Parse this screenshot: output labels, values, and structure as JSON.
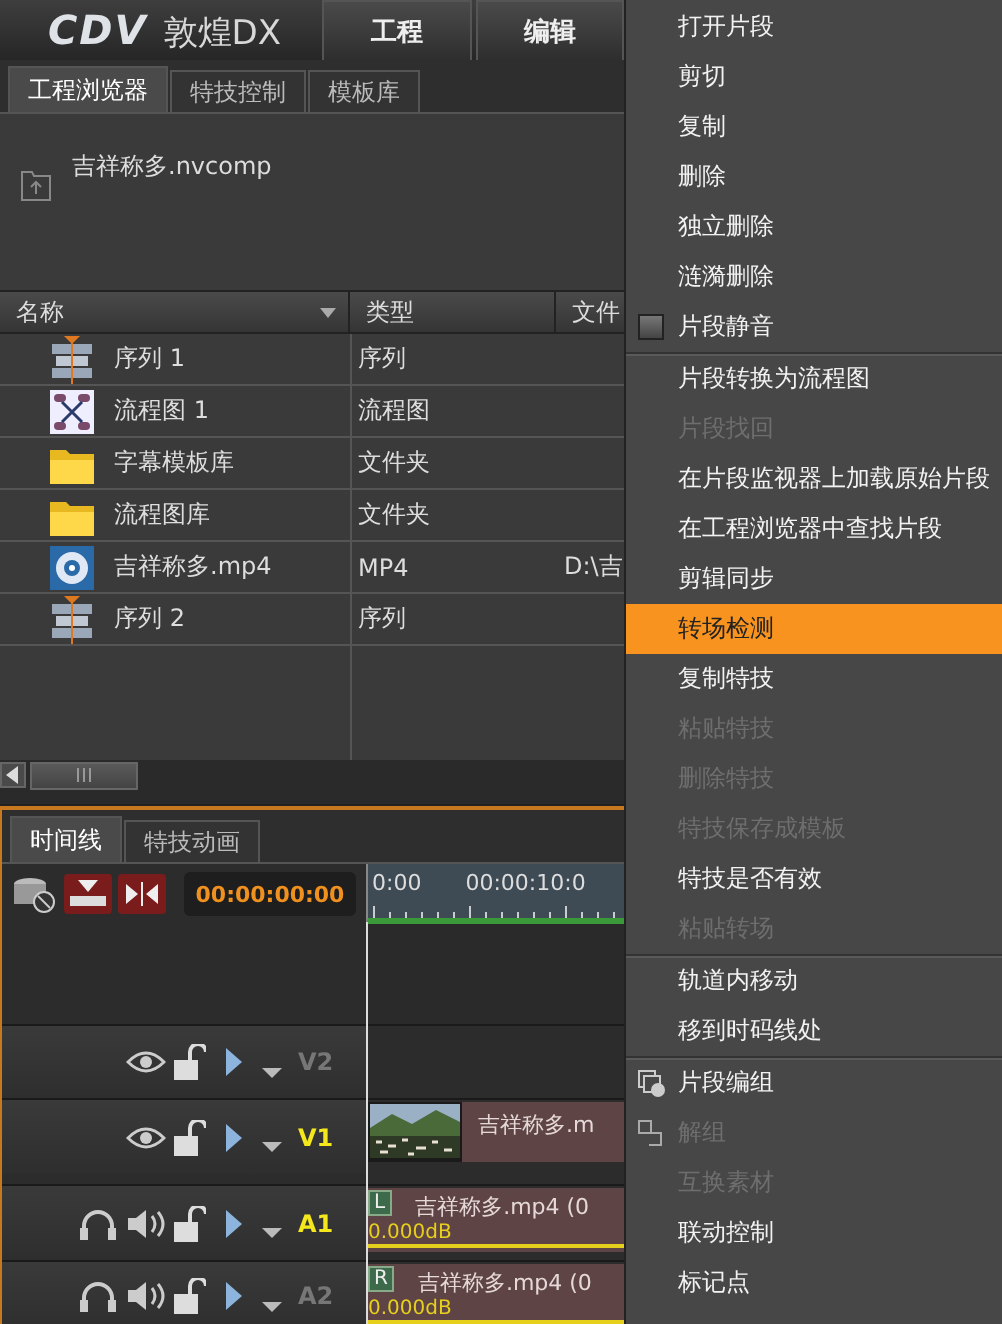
{
  "app": {
    "logo": "CDV",
    "product": "敦煌DX",
    "menus": [
      "工程",
      "编辑"
    ]
  },
  "browser": {
    "tabs": [
      {
        "label": "工程浏览器",
        "selected": true
      },
      {
        "label": "特技控制",
        "selected": false
      },
      {
        "label": "模板库",
        "selected": false
      }
    ],
    "project_file": "吉祥称多.nvcomp",
    "columns": [
      "名称",
      "类型",
      "文件"
    ],
    "rows": [
      {
        "kind": "sequence",
        "name": "序列 1",
        "type": "序列"
      },
      {
        "kind": "flowchart",
        "name": "流程图 1",
        "type": "流程图"
      },
      {
        "kind": "folder",
        "name": "字幕模板库",
        "type": "文件夹"
      },
      {
        "kind": "folder",
        "name": "流程图库",
        "type": "文件夹"
      },
      {
        "kind": "media",
        "name": "吉祥称多.mp4",
        "type": "MP4",
        "path": "D:\\吉"
      },
      {
        "kind": "sequence",
        "name": "序列 2",
        "type": "序列"
      }
    ]
  },
  "timeline": {
    "tabs": [
      {
        "label": "时间线",
        "selected": true
      },
      {
        "label": "特技动画",
        "selected": false
      }
    ],
    "timecode": "00:00:00:00",
    "ruler": [
      "0:00",
      "00:00:10:0"
    ],
    "tracks": [
      {
        "kind": "video",
        "name": "V2",
        "active": false
      },
      {
        "kind": "video",
        "name": "V1",
        "active": true,
        "clip": {
          "title": "吉祥称多.m"
        }
      },
      {
        "kind": "audio",
        "name": "A1",
        "active": true,
        "clip": {
          "channel": "L",
          "title": "吉祥称多.mp4 (0",
          "gain": "0.000dB"
        }
      },
      {
        "kind": "audio",
        "name": "A2",
        "active": false,
        "clip": {
          "channel": "R",
          "title": "吉祥称多.mp4 (0",
          "gain": "0.000dB"
        }
      }
    ]
  },
  "context_menu": {
    "sections": [
      [
        {
          "kind": "item",
          "label": "打开片段",
          "disabled": false,
          "selected": false
        },
        {
          "kind": "item",
          "label": "剪切",
          "disabled": false,
          "selected": false
        },
        {
          "kind": "item",
          "label": "复制",
          "disabled": false,
          "selected": false
        },
        {
          "kind": "item",
          "label": "删除",
          "disabled": false,
          "selected": false
        },
        {
          "kind": "item",
          "label": "独立删除",
          "disabled": false,
          "selected": false
        },
        {
          "kind": "item",
          "label": "涟漪删除",
          "disabled": false,
          "selected": false
        },
        {
          "kind": "checkbox",
          "label": "片段静音",
          "disabled": false,
          "selected": false,
          "checked": false
        }
      ],
      [
        {
          "kind": "item",
          "label": "片段转换为流程图",
          "disabled": false,
          "selected": false
        },
        {
          "kind": "item",
          "label": "片段找回",
          "disabled": true,
          "selected": false
        },
        {
          "kind": "item",
          "label": "在片段监视器上加载原始片段",
          "disabled": false,
          "selected": false
        },
        {
          "kind": "item",
          "label": "在工程浏览器中查找片段",
          "disabled": false,
          "selected": false
        },
        {
          "kind": "item",
          "label": "剪辑同步",
          "disabled": false,
          "selected": false
        },
        {
          "kind": "item",
          "label": "转场检测",
          "disabled": false,
          "selected": true
        },
        {
          "kind": "item",
          "label": "复制特技",
          "disabled": false,
          "selected": false
        },
        {
          "kind": "item",
          "label": "粘贴特技",
          "disabled": true,
          "selected": false
        },
        {
          "kind": "item",
          "label": "删除特技",
          "disabled": true,
          "selected": false
        },
        {
          "kind": "item",
          "label": "特技保存成模板",
          "disabled": true,
          "selected": false
        },
        {
          "kind": "item",
          "label": "特技是否有效",
          "disabled": false,
          "selected": false
        },
        {
          "kind": "item",
          "label": "粘贴转场",
          "disabled": true,
          "selected": false
        }
      ],
      [
        {
          "kind": "item",
          "label": "轨道内移动",
          "disabled": false,
          "selected": false
        },
        {
          "kind": "item",
          "label": "移到时码线处",
          "disabled": false,
          "selected": false
        }
      ],
      [
        {
          "kind": "group",
          "label": "片段编组",
          "disabled": false,
          "selected": false
        },
        {
          "kind": "ungroup",
          "label": "解组",
          "disabled": true,
          "selected": false
        },
        {
          "kind": "item",
          "label": "互换素材",
          "disabled": true,
          "selected": false
        },
        {
          "kind": "item",
          "label": "联动控制",
          "disabled": false,
          "selected": false
        },
        {
          "kind": "item",
          "label": "标记点",
          "disabled": false,
          "selected": false
        }
      ]
    ]
  }
}
